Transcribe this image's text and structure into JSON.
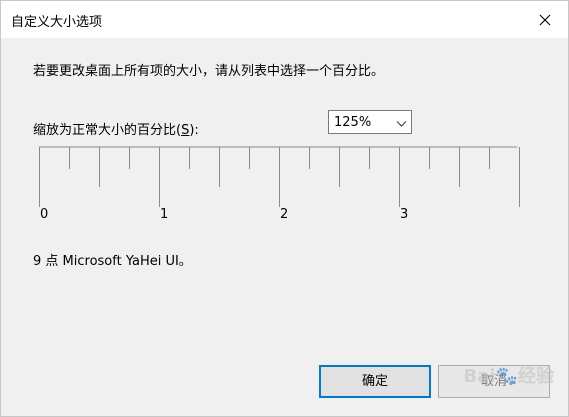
{
  "window": {
    "title": "自定义大小选项"
  },
  "dialog": {
    "instruction": "若要更改桌面上所有项的大小，请从列表中选择一个百分比。",
    "scale_label_prefix": "缩放为正常大小的百分比(",
    "scale_label_hotkey": "S",
    "scale_label_suffix": "):",
    "scale_value": "125%",
    "ruler_labels": [
      "0",
      "1",
      "2",
      "3"
    ],
    "font_info": "9 点 Microsoft YaHei UI。"
  },
  "buttons": {
    "ok_label": "确定",
    "cancel_label": "取消"
  },
  "watermark": "Baidu经验",
  "icons": {
    "close": "close-icon",
    "dropdown": "chevron-down-icon"
  },
  "colors": {
    "ok_border": "#0078d7",
    "titlebar_bg": "#ffffff",
    "dialog_bg": "#f0f0f0"
  }
}
